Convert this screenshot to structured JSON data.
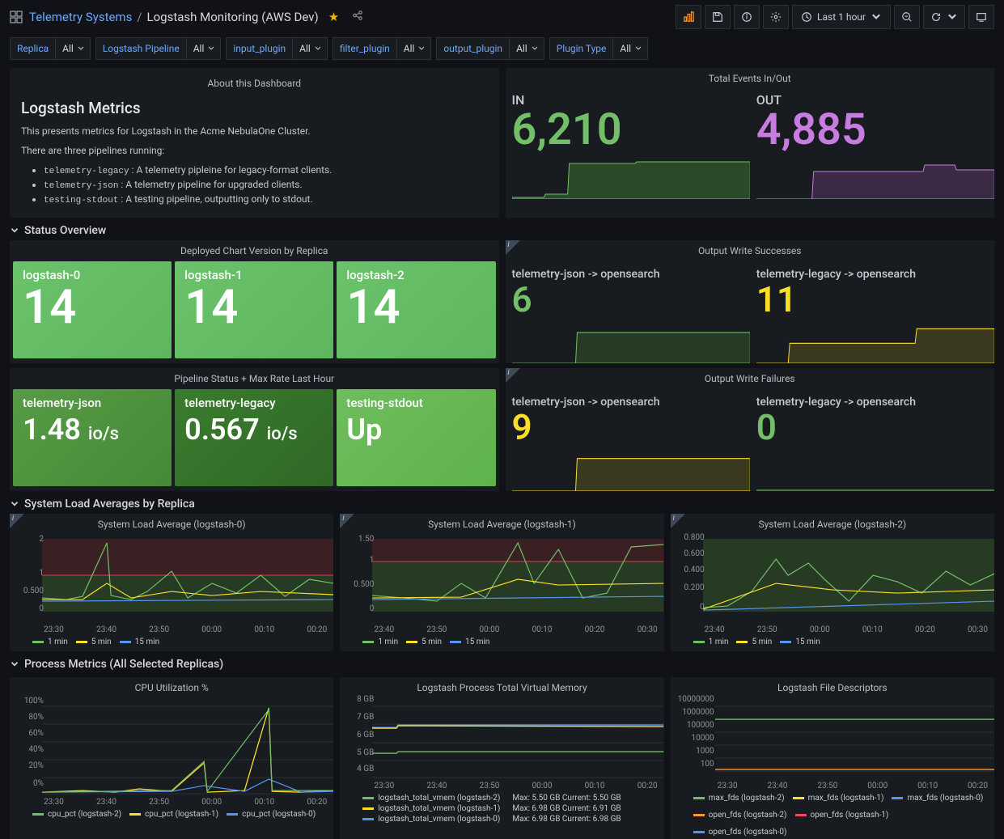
{
  "header": {
    "breadcrumb_root": "Telemetry Systems",
    "breadcrumb_current": "Logstash Monitoring (AWS Dev)"
  },
  "toolbar": {
    "timerange": "Last 1 hour"
  },
  "vars": [
    {
      "label": "Replica",
      "value": "All"
    },
    {
      "label": "Logstash Pipeline",
      "value": "All"
    },
    {
      "label": "input_plugin",
      "value": "All"
    },
    {
      "label": "filter_plugin",
      "value": "All"
    },
    {
      "label": "output_plugin",
      "value": "All"
    },
    {
      "label": "Plugin Type",
      "value": "All"
    }
  ],
  "about": {
    "panel_title": "About this Dashboard",
    "heading": "Logstash Metrics",
    "intro": "This presents metrics for Logstash in the Acme NebulaOne Cluster.",
    "subintro": "There are three pipelines running:",
    "items": [
      {
        "code": "telemetry-legacy",
        "desc": "A telemetry pipleine for legacy-format clients."
      },
      {
        "code": "telemetry-json",
        "desc": "A telemetry pipeline for upgraded clients."
      },
      {
        "code": "testing-stdout",
        "desc": "A testing pipeline, outputting only to stdout."
      }
    ]
  },
  "events_panel": {
    "title": "Total Events In/Out",
    "in_label": "IN",
    "in_value": "6,210",
    "out_label": "OUT",
    "out_value": "4,885"
  },
  "row_status": "Status Overview",
  "chart_version": {
    "title": "Deployed Chart Version by Replica",
    "cards": [
      {
        "name": "logstash-0",
        "value": "14"
      },
      {
        "name": "logstash-1",
        "value": "14"
      },
      {
        "name": "logstash-2",
        "value": "14"
      }
    ]
  },
  "pipeline_status": {
    "title": "Pipeline Status + Max Rate Last Hour",
    "cards": [
      {
        "name": "telemetry-json",
        "value": "1.48",
        "unit": "io/s"
      },
      {
        "name": "telemetry-legacy",
        "value": "0.567",
        "unit": "io/s"
      },
      {
        "name": "testing-stdout",
        "value": "Up",
        "unit": ""
      }
    ]
  },
  "write_success": {
    "title": "Output Write Successes",
    "items": [
      {
        "label": "telemetry-json -> opensearch",
        "value": "6",
        "color": "c-green"
      },
      {
        "label": "telemetry-legacy -> opensearch",
        "value": "11",
        "color": "c-yellow"
      }
    ]
  },
  "write_fail": {
    "title": "Output Write Failures",
    "items": [
      {
        "label": "telemetry-json -> opensearch",
        "value": "9",
        "color": "c-yellow"
      },
      {
        "label": "telemetry-legacy -> opensearch",
        "value": "0",
        "color": "c-green"
      }
    ]
  },
  "row_load": "System Load Averages by Replica",
  "load_charts": [
    {
      "title": "System Load Average (logstash-0)",
      "ymax": "2",
      "ymid": "1",
      "ylow": "0.500",
      "yzero": "0"
    },
    {
      "title": "System Load Average (logstash-1)",
      "ymax": "1.50",
      "ymid": "1",
      "ylow": "0.500",
      "yzero": "0"
    },
    {
      "title": "System Load Average (logstash-2)",
      "ymax": "0.800",
      "ymid2": "0.600",
      "ymid": "0.400",
      "ylow": "0.200",
      "yzero": "0"
    }
  ],
  "load_xlabels": [
    "23:30",
    "23:40",
    "23:50",
    "00:00",
    "00:10",
    "00:20"
  ],
  "load_xlabels_1": [
    "23:40",
    "23:50",
    "00:00",
    "00:10",
    "00:20",
    "00:30"
  ],
  "load_xlabels_2": [
    "23:40",
    "23:50",
    "00:00",
    "00:10",
    "00:20",
    "00:30"
  ],
  "load_legend": [
    {
      "label": "1 min",
      "sw": "sw-g"
    },
    {
      "label": "5 min",
      "sw": "sw-y"
    },
    {
      "label": "15 min",
      "sw": "sw-b"
    }
  ],
  "row_proc": "Process Metrics (All Selected Replicas)",
  "cpu": {
    "title": "CPU Utilization %",
    "ylabels": [
      "100%",
      "80%",
      "60%",
      "40%",
      "20%",
      "0%"
    ],
    "xlabels": [
      "23:30",
      "23:40",
      "23:50",
      "00:00",
      "00:10",
      "00:20"
    ],
    "legend": [
      {
        "label": "cpu_pct (logstash-2)",
        "sw": "sw-g"
      },
      {
        "label": "cpu_pct (logstash-1)",
        "sw": "sw-y"
      },
      {
        "label": "cpu_pct (logstash-0)",
        "sw": "sw-b"
      }
    ]
  },
  "vmem": {
    "title": "Logstash Process Total Virtual Memory",
    "ylabels": [
      "8 GB",
      "7 GB",
      "6 GB",
      "5 GB",
      "4 GB"
    ],
    "xlabels": [
      "23:30",
      "23:40",
      "23:50",
      "00:00",
      "00:10",
      "00:20"
    ],
    "legend": [
      {
        "label": "logstash_total_vmem (logstash-2)",
        "stats": "Max: 5.50 GB  Current: 5.50 GB",
        "sw": "sw-g"
      },
      {
        "label": "logstash_total_vmem (logstash-1)",
        "stats": "Max: 6.98 GB  Current: 6.91 GB",
        "sw": "sw-y"
      },
      {
        "label": "logstash_total_vmem (logstash-0)",
        "stats": "Max: 6.98 GB  Current: 6.98 GB",
        "sw": "sw-b"
      }
    ]
  },
  "fds": {
    "title": "Logstash File Descriptors",
    "ylabels": [
      "10000000",
      "1000000",
      "100000",
      "10000",
      "1000",
      "100"
    ],
    "xlabels": [
      "23:30",
      "23:40",
      "23:50",
      "00:00",
      "00:10",
      "00:20"
    ],
    "legend": [
      {
        "label": "max_fds (logstash-2)",
        "sw": "sw-g"
      },
      {
        "label": "max_fds (logstash-1)",
        "sw": "sw-y"
      },
      {
        "label": "max_fds (logstash-0)",
        "sw": "sw-b"
      },
      {
        "label": "open_fds (logstash-2)",
        "sw": "sw-o"
      },
      {
        "label": "open_fds (logstash-1)",
        "sw": "sw-r"
      },
      {
        "label": "open_fds (logstash-0)",
        "sw": "sw-b"
      }
    ]
  },
  "chart_data": [
    {
      "type": "line",
      "title": "Total Events In/Out",
      "series": [
        {
          "name": "IN",
          "final": 6210
        },
        {
          "name": "OUT",
          "final": 4885
        }
      ],
      "range_minutes": 60
    },
    {
      "type": "line",
      "title": "Output Write Successes",
      "series": [
        {
          "name": "telemetry-json->opensearch",
          "final": 6
        },
        {
          "name": "telemetry-legacy->opensearch",
          "final": 11
        }
      ],
      "range_minutes": 60
    },
    {
      "type": "line",
      "title": "Output Write Failures",
      "series": [
        {
          "name": "telemetry-json->opensearch",
          "final": 9
        },
        {
          "name": "telemetry-legacy->opensearch",
          "final": 0
        }
      ],
      "range_minutes": 60
    },
    {
      "type": "line",
      "title": "System Load Average (logstash-0)",
      "x_range": [
        "23:30",
        "00:30"
      ],
      "ylim": [
        0,
        2
      ],
      "series": [
        {
          "name": "1 min",
          "approx_values": [
            0.5,
            0.5,
            0.6,
            2.0,
            0.7,
            0.5,
            0.8,
            1.2,
            0.6,
            0.8,
            0.7,
            1.0
          ]
        },
        {
          "name": "5 min",
          "approx_values": [
            0.5,
            0.5,
            0.5,
            0.8,
            0.6,
            0.5,
            0.6,
            0.7,
            0.5,
            0.6,
            0.5,
            0.6
          ]
        },
        {
          "name": "15 min",
          "approx_values": [
            0.5,
            0.5,
            0.5,
            0.55,
            0.55,
            0.5,
            0.5,
            0.55,
            0.5,
            0.5,
            0.5,
            0.5
          ]
        }
      ],
      "thresholds": [
        1,
        2
      ]
    },
    {
      "type": "line",
      "title": "System Load Average (logstash-1)",
      "x_range": [
        "23:30",
        "00:30"
      ],
      "ylim": [
        0,
        1.5
      ],
      "series": [
        {
          "name": "1 min",
          "approx_values": [
            0.5,
            0.5,
            0.4,
            0.7,
            0.5,
            0.5,
            1.4,
            0.7,
            1.2,
            0.5,
            0.6,
            1.4
          ]
        },
        {
          "name": "5 min",
          "approx_values": [
            0.5,
            0.5,
            0.4,
            0.55,
            0.5,
            0.5,
            0.8,
            0.6,
            0.7,
            0.5,
            0.55,
            0.8
          ]
        },
        {
          "name": "15 min",
          "approx_values": [
            0.5,
            0.5,
            0.45,
            0.5,
            0.5,
            0.5,
            0.55,
            0.5,
            0.55,
            0.5,
            0.5,
            0.55
          ]
        }
      ],
      "thresholds": [
        1
      ]
    },
    {
      "type": "line",
      "title": "System Load Average (logstash-2)",
      "x_range": [
        "23:30",
        "00:30"
      ],
      "ylim": [
        0,
        0.8
      ],
      "series": [
        {
          "name": "1 min",
          "approx_values": [
            0.08,
            0.1,
            0.2,
            0.5,
            0.35,
            0.45,
            0.3,
            0.15,
            0.35,
            0.3,
            0.2,
            0.4
          ]
        },
        {
          "name": "5 min",
          "approx_values": [
            0.08,
            0.1,
            0.15,
            0.3,
            0.25,
            0.3,
            0.25,
            0.15,
            0.25,
            0.22,
            0.18,
            0.25
          ]
        },
        {
          "name": "15 min",
          "approx_values": [
            0.08,
            0.1,
            0.12,
            0.18,
            0.18,
            0.2,
            0.2,
            0.15,
            0.18,
            0.18,
            0.16,
            0.18
          ]
        }
      ]
    },
    {
      "type": "line",
      "title": "CPU Utilization %",
      "x_range": [
        "23:26",
        "00:26"
      ],
      "ylim": [
        0,
        100
      ],
      "series": [
        {
          "name": "cpu_pct (logstash-2)",
          "approx_values": [
            2,
            3,
            2,
            4,
            3,
            2,
            4,
            36,
            3,
            2,
            3,
            90,
            4,
            3
          ]
        },
        {
          "name": "cpu_pct (logstash-1)",
          "approx_values": [
            2,
            3,
            2,
            3,
            3,
            2,
            3,
            8,
            3,
            2,
            3,
            88,
            3,
            3
          ]
        },
        {
          "name": "cpu_pct (logstash-0)",
          "approx_values": [
            2,
            2,
            2,
            3,
            2,
            2,
            3,
            6,
            2,
            2,
            2,
            12,
            2,
            2
          ]
        }
      ]
    },
    {
      "type": "line",
      "title": "Logstash Process Total Virtual Memory",
      "x_range": [
        "23:26",
        "00:26"
      ],
      "ylim": [
        4,
        8
      ],
      "unit": "GB",
      "series": [
        {
          "name": "logstash_total_vmem (logstash-2)",
          "max": 5.5,
          "current": 5.5
        },
        {
          "name": "logstash_total_vmem (logstash-1)",
          "max": 6.98,
          "current": 6.91
        },
        {
          "name": "logstash_total_vmem (logstash-0)",
          "max": 6.98,
          "current": 6.98
        }
      ]
    },
    {
      "type": "line",
      "title": "Logstash File Descriptors",
      "x_range": [
        "23:26",
        "00:26"
      ],
      "yscale": "log",
      "ylim": [
        100,
        10000000
      ],
      "series": [
        {
          "name": "max_fds (logstash-2)",
          "approx": 1048576
        },
        {
          "name": "max_fds (logstash-1)",
          "approx": 1048576
        },
        {
          "name": "max_fds (logstash-0)",
          "approx": 1048576
        },
        {
          "name": "open_fds (logstash-2)",
          "approx": 140
        },
        {
          "name": "open_fds (logstash-1)",
          "approx": 140
        },
        {
          "name": "open_fds (logstash-0)",
          "approx": 140
        }
      ]
    }
  ]
}
